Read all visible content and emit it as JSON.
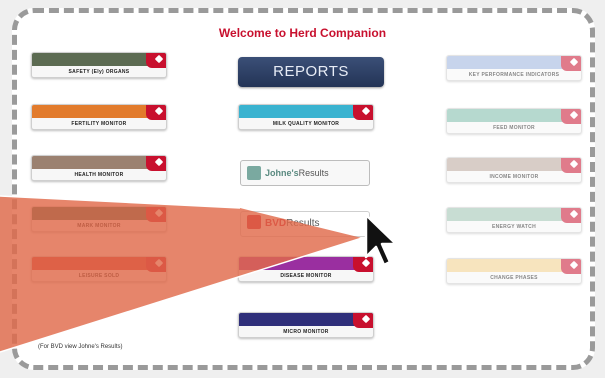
{
  "title": "Welcome to Herd Companion",
  "reports_label": "REPORTS",
  "left_tiles": [
    {
      "label": "SAFETY (Ely) ORGANS",
      "band": "#5c6b52"
    },
    {
      "label": "FERTILITY MONITOR",
      "band": "#e27b2c"
    },
    {
      "label": "HEALTH MONITOR",
      "band": "#9b8170"
    },
    {
      "label": "MARK MONITOR",
      "band": "#2f6b52"
    },
    {
      "label": "LEISURE SOLD",
      "band": "#cf3b3b"
    }
  ],
  "middle_tiles": [
    {
      "label": "MILK QUALITY MONITOR",
      "band": "#3ab3d0"
    },
    {
      "label": "DISEASE MONITOR",
      "band": "#9a2fa0"
    },
    {
      "label": "MICRO MONITOR",
      "band": "#2f2f7a"
    }
  ],
  "right_tiles": [
    {
      "label": "KEY PERFORMANCE INDICATORS",
      "band": "#9bb2dd"
    },
    {
      "label": "FEED MONITOR",
      "band": "#7bbba9"
    },
    {
      "label": "INCOME MONITOR",
      "band": "#b9a69b"
    },
    {
      "label": "ENERGY WATCH",
      "band": "#9cc3b0"
    },
    {
      "label": "CHANGE PHASES",
      "band": "#f2cf8a"
    }
  ],
  "johnes_result": {
    "part1": "Johne's",
    "part2": "Results"
  },
  "bvd_result": {
    "part1": "BVD",
    "part2": "Results"
  },
  "footer_text": "(For BVD view Johne's Results)",
  "colors": {
    "accent": "#c8102e",
    "frame": "#9a9a9a",
    "cone": "#e06a4a"
  }
}
